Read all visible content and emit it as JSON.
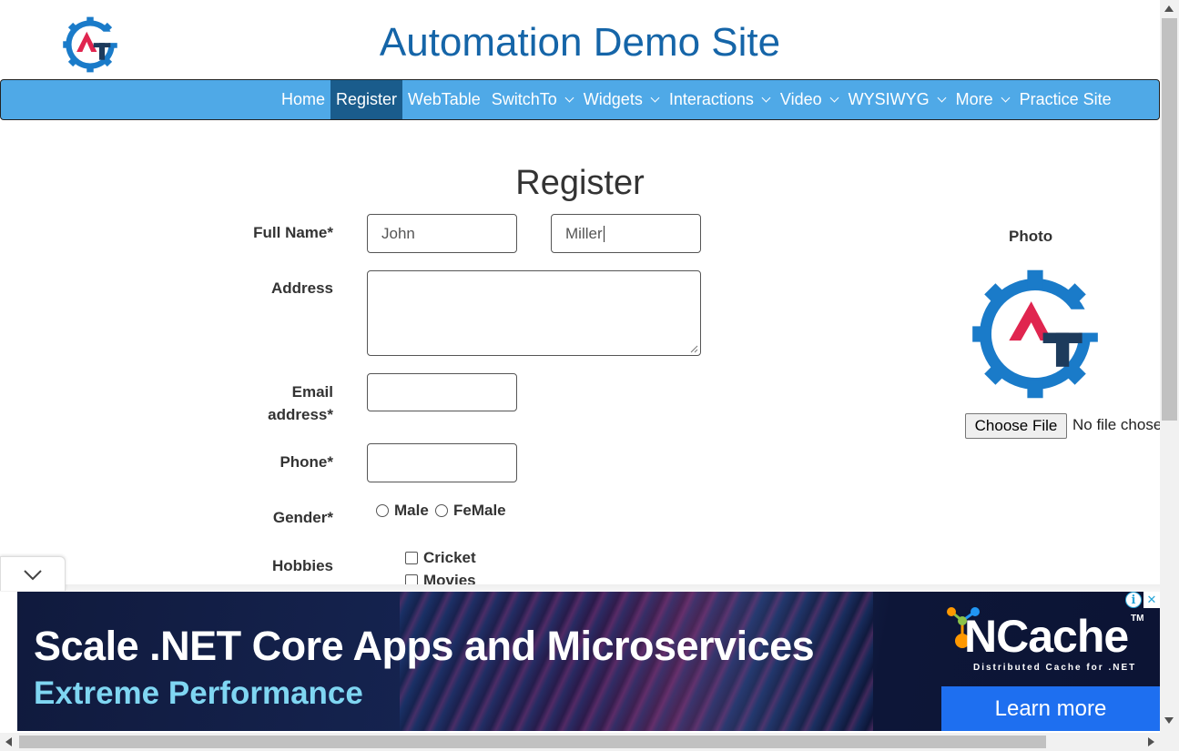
{
  "header": {
    "title": "Automation Demo Site"
  },
  "nav": {
    "items": [
      {
        "label": "Home",
        "dropdown": false,
        "active": false
      },
      {
        "label": "Register",
        "dropdown": false,
        "active": true
      },
      {
        "label": "WebTable",
        "dropdown": false,
        "active": false
      },
      {
        "label": "SwitchTo",
        "dropdown": true,
        "active": false
      },
      {
        "label": "Widgets",
        "dropdown": true,
        "active": false
      },
      {
        "label": "Interactions",
        "dropdown": true,
        "active": false
      },
      {
        "label": "Video",
        "dropdown": true,
        "active": false
      },
      {
        "label": "WYSIWYG",
        "dropdown": true,
        "active": false
      },
      {
        "label": "More",
        "dropdown": true,
        "active": false
      },
      {
        "label": "Practice Site",
        "dropdown": false,
        "active": false
      }
    ]
  },
  "form": {
    "heading": "Register",
    "full_name_label": "Full Name*",
    "first_name_value": "John",
    "last_name_value": "Miller",
    "address_label": "Address",
    "address_value": "",
    "email_label": "Email address*",
    "email_value": "",
    "phone_label": "Phone*",
    "phone_value": "",
    "gender_label": "Gender*",
    "gender_options": [
      "Male",
      "FeMale"
    ],
    "hobbies_label": "Hobbies",
    "hobby_options": [
      "Cricket",
      "Movies"
    ]
  },
  "photo": {
    "label": "Photo",
    "choose_file_label": "Choose File",
    "no_file_text": "No file chosen"
  },
  "ad": {
    "headline": "Scale .NET Core Apps and Microservices",
    "subline": "Extreme Performance",
    "brand": "NCache",
    "tm": "TM",
    "tagline": "Distributed Cache for .NET",
    "cta": "Learn more",
    "info_icon": "i",
    "close_icon": "✕"
  },
  "colors": {
    "title_blue": "#1565a8",
    "navbar_bg": "#4fa9e7",
    "navbar_active": "#1a5c8c",
    "logo_blue": "#1a7bc9",
    "logo_red": "#e0254f",
    "logo_navy": "#1d3b5c"
  }
}
